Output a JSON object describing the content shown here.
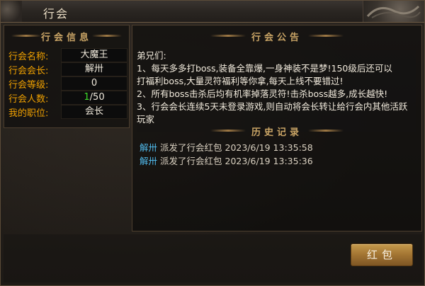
{
  "window": {
    "title": "行会"
  },
  "left": {
    "header": "行会信息",
    "rows": [
      {
        "label": "行会名称:",
        "value": "大魔王"
      },
      {
        "label": "行会会长:",
        "value": "解卅"
      },
      {
        "label": "行会等级:",
        "value": "0"
      },
      {
        "label": "行会人数:",
        "value_current": "1",
        "value_max": "/50"
      },
      {
        "label": "我的职位:",
        "value": "会长"
      }
    ]
  },
  "right": {
    "notice_header": "行会公告",
    "notice_lines": [
      "弟兄们:",
      "1、每天多多打boss,装备全靠爆,一身神装不是梦!150级后还可以",
      "打福利boss,大量灵符福利等你拿,每天上线不要错过!",
      "2、所有boss击杀后均有机率掉落灵符!击杀boss越多,成长越快!",
      "3、行会会长连续5天未登录游戏,则自动将会长转让给行会内其他活跃",
      "玩家"
    ],
    "history_header": "历史记录",
    "history": [
      {
        "who": "解卅",
        "text": "派发了行会红包 2023/6/19 13:35:58"
      },
      {
        "who": "解卅",
        "text": "派发了行会红包 2023/6/19 13:35:36"
      }
    ]
  },
  "buttons": {
    "red_packet": "红包"
  },
  "colors": {
    "label_orange": "#f0a100",
    "name_blue": "#4fb7e8",
    "accent_gold": "#c9a465",
    "count_green": "#3edc2a"
  }
}
